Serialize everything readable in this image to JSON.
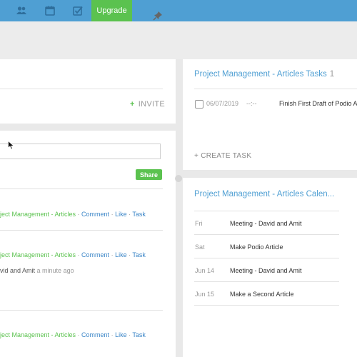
{
  "topbar": {
    "icons": [
      "contacts-icon",
      "calendar-icon",
      "tasks-check-icon"
    ],
    "upgrade_label": "Upgrade"
  },
  "workspace": {
    "invite_label": "INVITE"
  },
  "stream": {
    "share_label": "Share",
    "items": [
      {
        "app": "ject Management - Articles",
        "sep": " · ",
        "comment": "Comment",
        "like": "Like",
        "task": "Task"
      },
      {
        "app": "ject Management - Articles",
        "sep": " · ",
        "comment": "Comment",
        "like": "Like",
        "task": "Task",
        "meta_who": "vid and Amit",
        "meta_time": "a minute ago"
      },
      {
        "app": "ject Management - Articles",
        "sep": " · ",
        "comment": "Comment",
        "like": "Like",
        "task": "Task"
      }
    ]
  },
  "tasks_card": {
    "title": "Project Management - Articles Tasks",
    "count": "1",
    "task": {
      "date": "06/07/2019",
      "time": "--:--",
      "title": "Finish First Draft of Podio A"
    },
    "create_label": "+ CREATE TASK"
  },
  "calendar_card": {
    "title": "Project Management - Articles Calen...",
    "events": [
      {
        "day": "Fri",
        "title": "Meeting - David and Amit"
      },
      {
        "day": "Sat",
        "title": "Make Podio Article"
      },
      {
        "day": "Jun 14",
        "title": "Meeting - David and Amit"
      },
      {
        "day": "Jun 15",
        "title": "Make a Second Article"
      }
    ]
  }
}
